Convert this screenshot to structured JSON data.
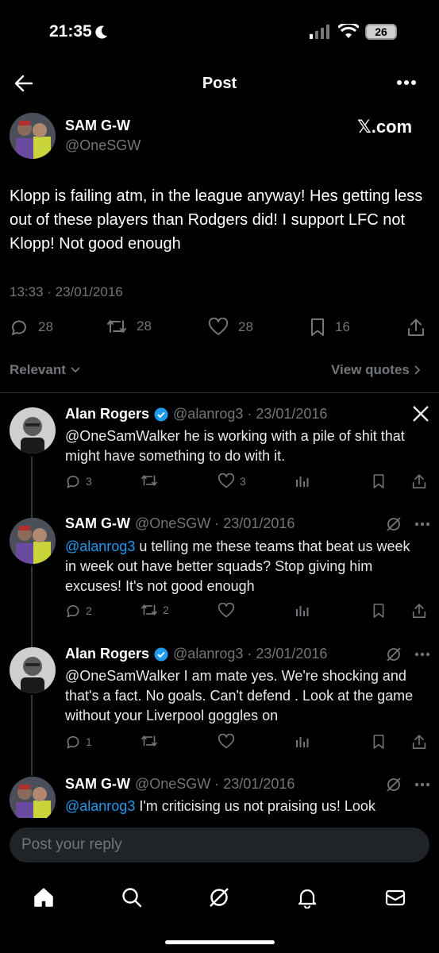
{
  "status_bar": {
    "time": "21:35",
    "battery": "26"
  },
  "header": {
    "title": "Post"
  },
  "post": {
    "author_name": "SAM G-W",
    "author_handle": "@OneSGW",
    "source": "𝕏.com",
    "text": "Klopp is failing atm, in the league anyway! Hes getting less out of these players than Rodgers did! I support LFC not Klopp! Not good enough",
    "timestamp": "13:33 · 23/01/2016",
    "stats": {
      "replies": "28",
      "reposts": "28",
      "likes": "28",
      "bookmarks": "16"
    }
  },
  "filters": {
    "left": "Relevant",
    "right": "View quotes"
  },
  "replies": [
    {
      "name": "Alan Rogers",
      "meta": "@alanrog3 · 23/01/2016",
      "mention": "",
      "text": "@OneSamWalker he is working with a pile of shit that might have something to do with it.",
      "replies": "3",
      "reposts": "",
      "likes": "3"
    },
    {
      "name": "SAM G-W",
      "meta": "@OneSGW · 23/01/2016",
      "mention": "@alanrog3",
      "text": " u telling me these teams that beat us week in week out have better squads? Stop giving him excuses! It's not good enough",
      "replies": "2",
      "reposts": "2",
      "likes": ""
    },
    {
      "name": "Alan Rogers",
      "meta": "@alanrog3 · 23/01/2016",
      "mention": "",
      "text": "@OneSamWalker I am mate yes. We're shocking and that's a fact. No goals. Can't defend . Look at the game without your Liverpool goggles on",
      "replies": "1",
      "reposts": "",
      "likes": ""
    },
    {
      "name": "SAM G-W",
      "meta": "@OneSGW · 23/01/2016",
      "mention": "@alanrog3",
      "text": " I'm criticising us not praising us! Look",
      "replies": "",
      "reposts": "",
      "likes": ""
    }
  ],
  "reply_input": {
    "placeholder": "Post your reply"
  },
  "colors": {
    "accent": "#1d9bf0",
    "muted": "#71767b",
    "verified": "#1d9bf0"
  }
}
